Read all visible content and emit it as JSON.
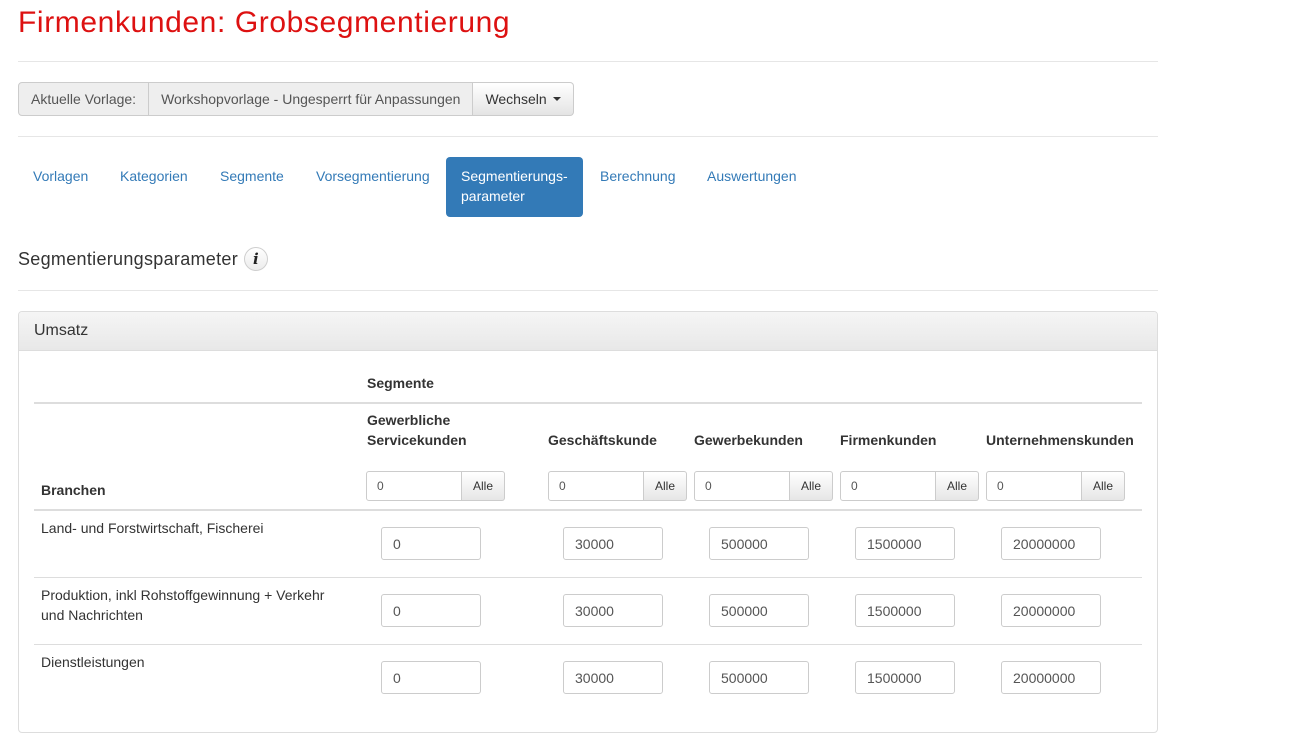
{
  "page": {
    "title": "Firmenkunden: Grobsegmentierung"
  },
  "template": {
    "label": "Aktuelle Vorlage:",
    "current": "Workshopvorlage - Ungesperrt für Anpassungen",
    "switch_label": "Wechseln"
  },
  "nav": {
    "items": [
      {
        "label": "Vorlagen"
      },
      {
        "label": "Kategorien"
      },
      {
        "label": "Segmente"
      },
      {
        "label": "Vorsegmentierung"
      },
      {
        "label_line1": "Segmentierungs-",
        "label_line2": "parameter",
        "active": true
      },
      {
        "label": "Berechnung"
      },
      {
        "label": "Auswertungen"
      }
    ]
  },
  "section": {
    "title": "Segmentierungsparameter",
    "info_icon": "info-icon"
  },
  "panel": {
    "title": "Umsatz",
    "segments_header": "Segmente",
    "branchen_header": "Branchen",
    "all_button_label": "Alle",
    "columns": [
      {
        "line1": "Gewerbliche",
        "line2": "Servicekunden",
        "all_value": "0"
      },
      {
        "line1": "Geschäftskunde",
        "all_value": "0"
      },
      {
        "line1": "Gewerbekunden",
        "all_value": "0"
      },
      {
        "line1": "Firmenkunden",
        "all_value": "0"
      },
      {
        "line1": "Unternehmenskunden",
        "all_value": "0"
      }
    ],
    "rows": [
      {
        "line1": "Land- und Forstwirtschaft, Fischerei",
        "values": [
          "0",
          "30000",
          "500000",
          "1500000",
          "20000000"
        ]
      },
      {
        "line1": "Produktion, inkl Rohstoffgewinnung + Verkehr",
        "line2": "und Nachrichten",
        "values": [
          "0",
          "30000",
          "500000",
          "1500000",
          "20000000"
        ]
      },
      {
        "line1": "Dienstleistungen",
        "values": [
          "0",
          "30000",
          "500000",
          "1500000",
          "20000000"
        ]
      }
    ]
  }
}
